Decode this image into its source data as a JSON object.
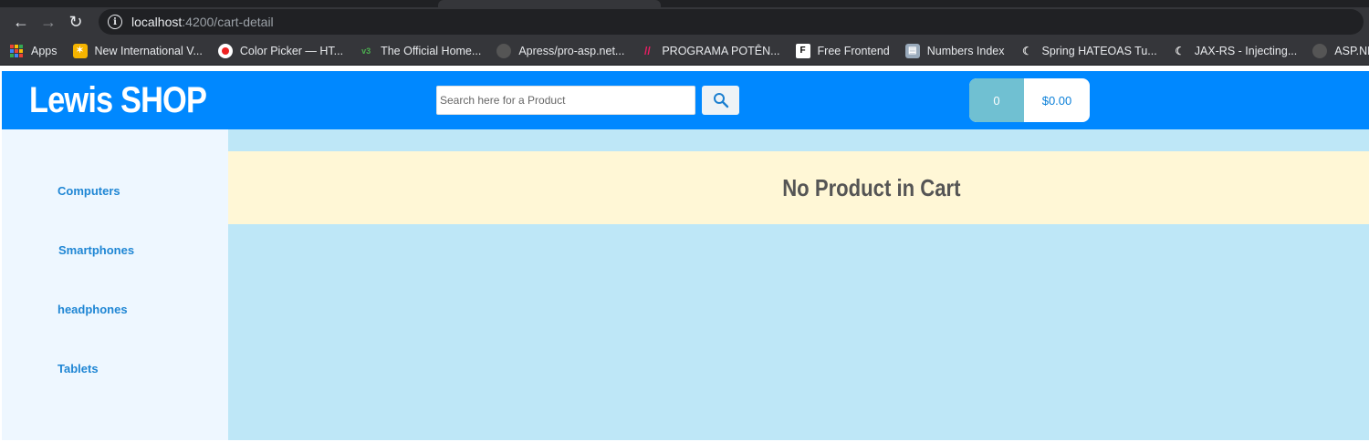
{
  "browser": {
    "url_host": "localhost",
    "url_path": ":4200/cart-detail",
    "bookmarks": [
      {
        "label": "Apps",
        "icon": "apps-grid-icon"
      },
      {
        "label": "New International V...",
        "icon": "star-bookmark-icon",
        "color": "#f5b400"
      },
      {
        "label": "Color Picker — HT...",
        "icon": "color-picker-icon",
        "color": "#e23"
      },
      {
        "label": "The Official Home...",
        "icon": "leaf-icon",
        "color": "#4caf50"
      },
      {
        "label": "Apress/pro-asp.net...",
        "icon": "github-icon",
        "color": "#555"
      },
      {
        "label": "PROGRAMA POTÊN...",
        "icon": "slash-logo-icon",
        "color": "#e91e63"
      },
      {
        "label": "Free Frontend",
        "icon": "ff-logo-icon",
        "color": "#ffffff"
      },
      {
        "label": "Numbers Index",
        "icon": "numbers-icon",
        "color": "#8ab"
      },
      {
        "label": "Spring HATEOAS Tu...",
        "icon": "moon-icon",
        "color": "#ddd"
      },
      {
        "label": "JAX-RS - Injecting...",
        "icon": "moon-icon",
        "color": "#ddd"
      },
      {
        "label": "ASP.NETCoreWebA...",
        "icon": "github-icon",
        "color": "#555"
      }
    ]
  },
  "header": {
    "logo": "Lewis SHOP",
    "search_placeholder": "Search here for a Product",
    "cart_count": "0",
    "cart_total": "$0.00"
  },
  "sidebar": {
    "items": [
      {
        "label": "Computers"
      },
      {
        "label": "Smartphones"
      },
      {
        "label": "headphones"
      },
      {
        "label": "Tablets"
      }
    ]
  },
  "content": {
    "empty_message": "No Product in Cart"
  },
  "colors": {
    "header_bg": "#0088ff",
    "sidebar_bg": "#eef7ff",
    "content_bg": "#bee7f7",
    "notice_bg": "#fff7d6",
    "link": "#1f86d4"
  }
}
